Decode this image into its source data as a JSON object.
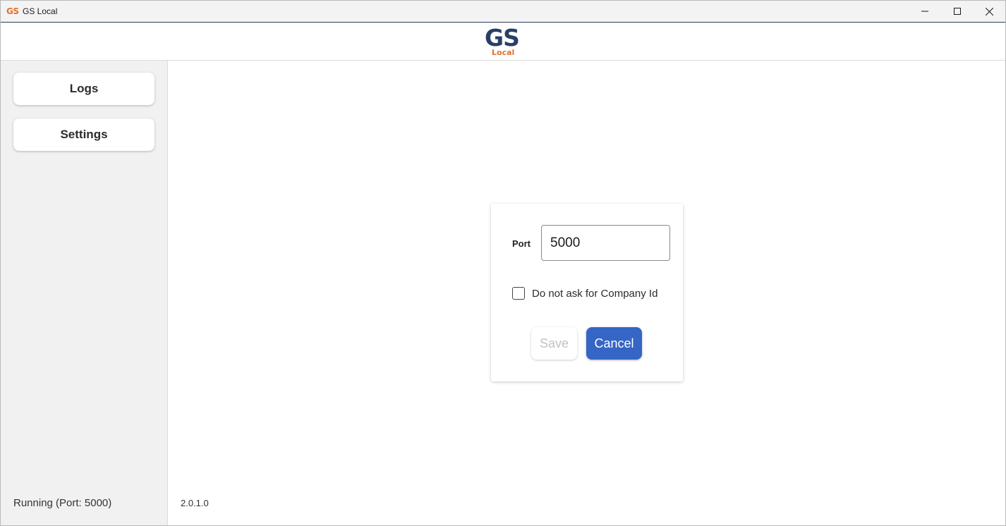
{
  "window": {
    "logo_text": "GS",
    "title": "GS Local",
    "minimize_icon": "minimize-icon",
    "maximize_icon": "maximize-icon",
    "close_icon": "close-icon"
  },
  "header": {
    "brand_main": "GS",
    "brand_sub": "Local",
    "brand_main_color": "#2a3f66",
    "brand_sub_color": "#e4712d"
  },
  "sidebar": {
    "items": [
      {
        "label": "Logs"
      },
      {
        "label": "Settings"
      }
    ],
    "status": "Running (Port: 5000)"
  },
  "main": {
    "version": "2.0.1.0"
  },
  "settings_form": {
    "port_label": "Port",
    "port_value": "5000",
    "checkbox_label": "Do not ask for Company Id",
    "checkbox_checked": false,
    "save_label": "Save",
    "cancel_label": "Cancel",
    "accent_color": "#3565c5"
  }
}
